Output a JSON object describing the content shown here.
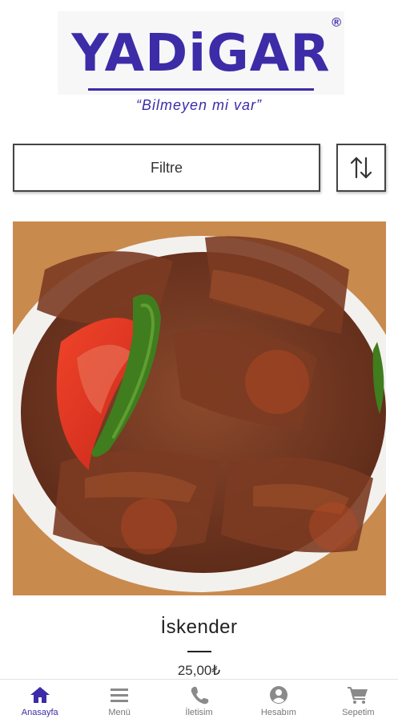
{
  "brand": {
    "logo_text": "YADiGAR",
    "registered_mark": "®",
    "slogan": "“Bilmeyen mi var”",
    "color": "#3c2ca8"
  },
  "toolbar": {
    "filter_label": "Filtre",
    "sort_icon": "sort-arrows-icon"
  },
  "product": {
    "name": "İskender",
    "price": "25,00₺",
    "image_icon": "food-photo"
  },
  "bottom_nav": {
    "items": [
      {
        "label": "Anasayfa",
        "icon": "home-icon",
        "active": true
      },
      {
        "label": "Menü",
        "icon": "menu-icon",
        "active": false
      },
      {
        "label": "İletisim",
        "icon": "phone-icon",
        "active": false
      },
      {
        "label": "Hesabım",
        "icon": "account-icon",
        "active": false
      },
      {
        "label": "Sepetim",
        "icon": "cart-icon",
        "active": false
      }
    ],
    "active_color": "#3c2ca8",
    "inactive_color": "#8a8a8a"
  }
}
